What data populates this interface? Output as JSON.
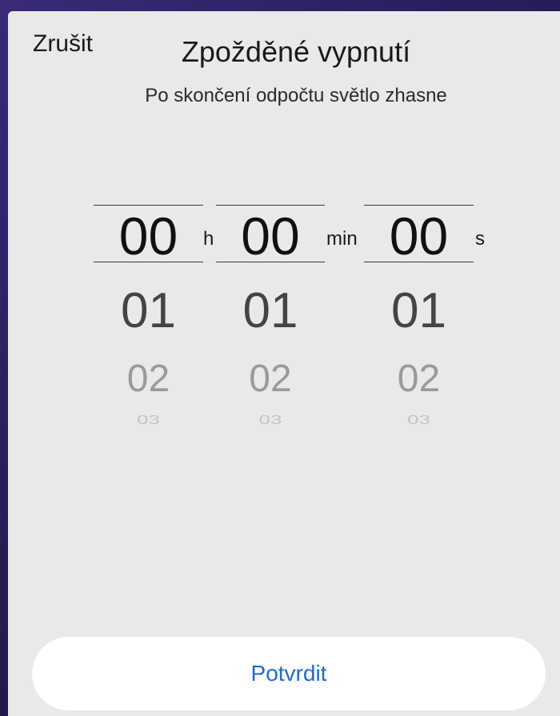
{
  "header": {
    "cancel_label": "Zrušit",
    "title": "Zpožděné vypnutí",
    "subtitle": "Po skončení odpočtu světlo zhasne"
  },
  "picker": {
    "hours": {
      "selected": "00",
      "next1": "01",
      "next2": "02",
      "next3": "03",
      "unit": "h"
    },
    "minutes": {
      "selected": "00",
      "next1": "01",
      "next2": "02",
      "next3": "03",
      "unit": "min"
    },
    "seconds": {
      "selected": "00",
      "next1": "01",
      "next2": "02",
      "next3": "03",
      "unit": "s"
    }
  },
  "footer": {
    "confirm_label": "Potvrdit"
  },
  "colors": {
    "sheet_background": "#e9e9e9",
    "confirm_text": "#1d6bd7",
    "backdrop": "#2a1f5e"
  }
}
